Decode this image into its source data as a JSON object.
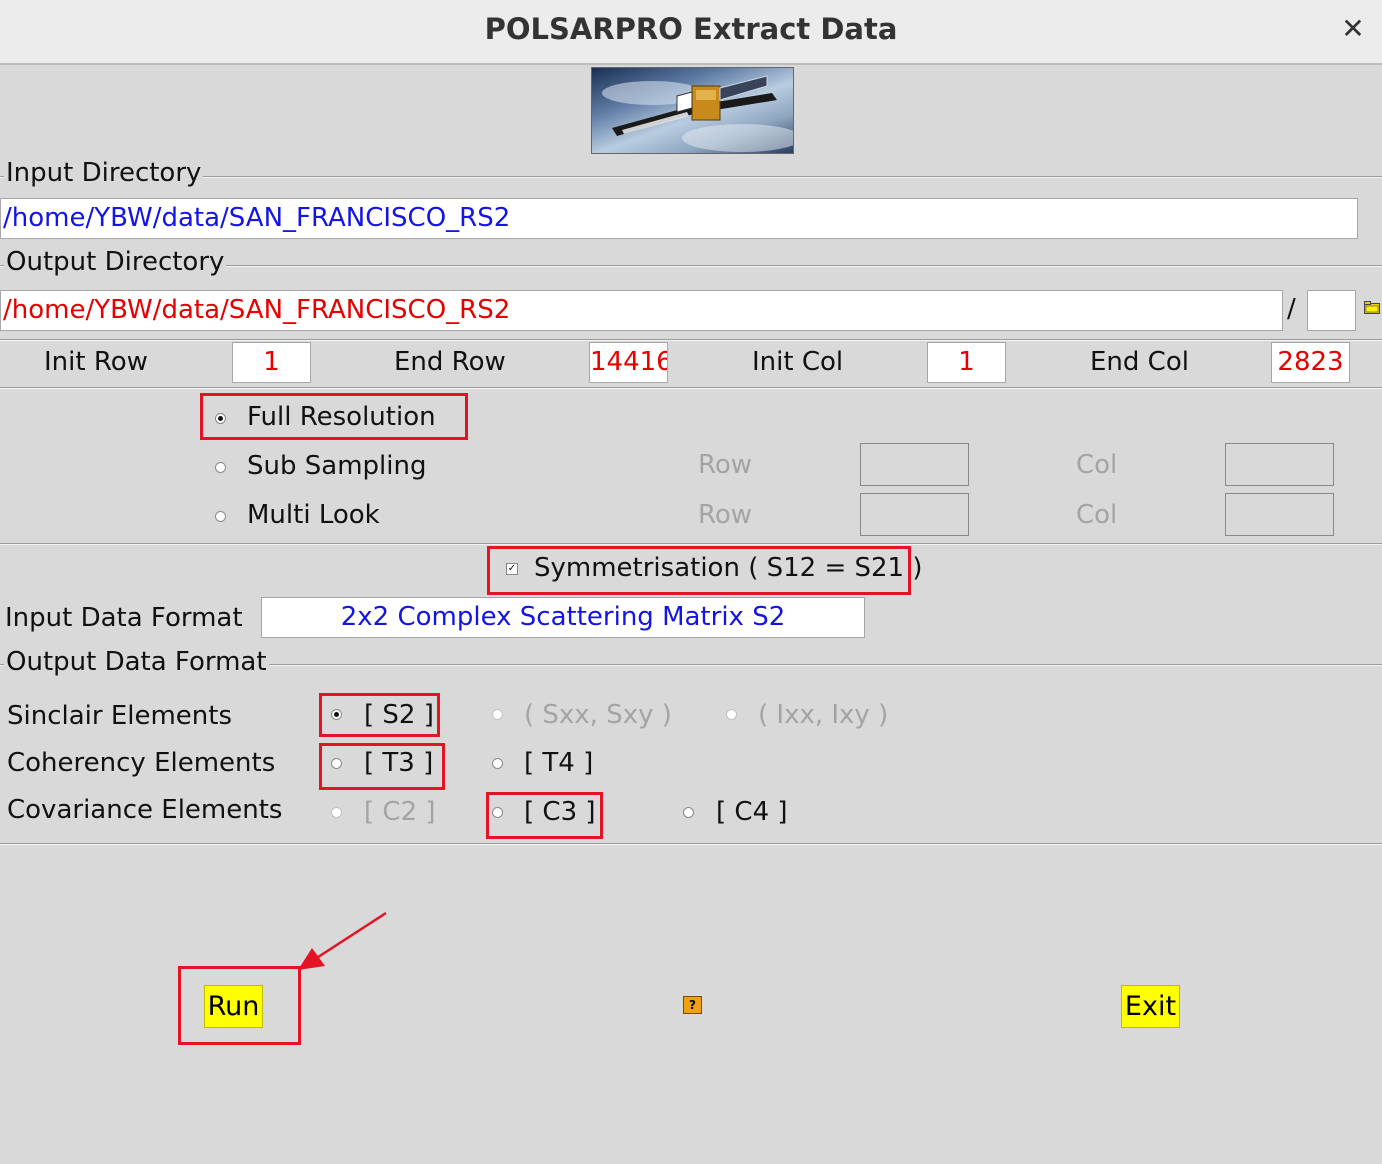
{
  "window": {
    "title": "POLSARPRO Extract Data",
    "close_glyph": "✕"
  },
  "input_directory": {
    "label": "Input Directory",
    "value": "/home/YBW/data/SAN_FRANCISCO_RS2"
  },
  "output_directory": {
    "label": "Output Directory",
    "value": "/home/YBW/data/SAN_FRANCISCO_RS2",
    "separator": "/",
    "subdir_value": ""
  },
  "extent": {
    "init_row": {
      "label": "Init Row",
      "value": "1"
    },
    "end_row": {
      "label": "End Row",
      "value": "14416"
    },
    "init_col": {
      "label": "Init Col",
      "value": "1"
    },
    "end_col": {
      "label": "End Col",
      "value": "2823"
    }
  },
  "resolution": {
    "selected": "full_resolution",
    "full_resolution": "Full Resolution",
    "sub_sampling": "Sub Sampling",
    "multi_look": "Multi Look",
    "row_label": "Row",
    "col_label": "Col"
  },
  "symmetrisation": {
    "label": "Symmetrisation ( S12 = S21 )",
    "checked": true
  },
  "input_format": {
    "label": "Input Data Format",
    "value": "2x2 Complex Scattering Matrix S2"
  },
  "output_format": {
    "label": "Output Data Format",
    "selected": "[ S2 ]",
    "rows": [
      {
        "label": "Sinclair Elements",
        "options": [
          "[ S2 ]",
          "( Sxx, Sxy )",
          "( Ixx, Ixy )"
        ]
      },
      {
        "label": "Coherency Elements",
        "options": [
          "[ T3 ]",
          "[ T4 ]"
        ]
      },
      {
        "label": "Covariance Elements",
        "options": [
          "[ C2 ]",
          "[ C3 ]",
          "[ C4 ]"
        ]
      }
    ]
  },
  "buttons": {
    "run": "Run",
    "exit": "Exit",
    "help": "?"
  },
  "colors": {
    "highlight_red": "#e41424",
    "button_yellow": "#ffff00",
    "value_blue": "#1414e6",
    "value_red": "#e60000"
  },
  "icons": {
    "close": "close-icon",
    "folder": "folder-icon",
    "help": "help-icon",
    "banner": "satellite-banner-image"
  }
}
